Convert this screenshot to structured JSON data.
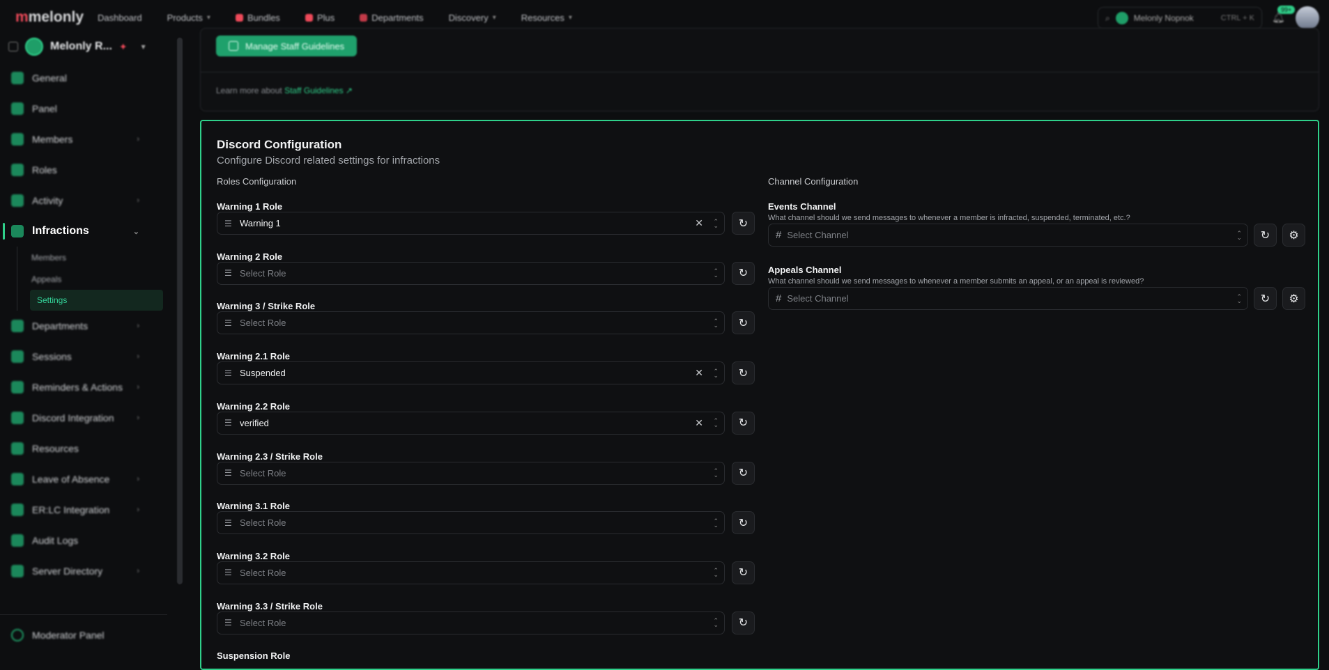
{
  "topnav": {
    "logo": "melonly",
    "items": [
      "Dashboard",
      "Products",
      "Bundles",
      "Plus",
      "Departments",
      "Discovery",
      "Resources"
    ],
    "search_server": "Melonly Nopnok",
    "search_shortcut": "CTRL + K",
    "notification_count": "99+"
  },
  "sidebar": {
    "server_name": "Melonly R...",
    "items": {
      "general": "General",
      "panel": "Panel",
      "members": "Members",
      "roles": "Roles",
      "activity": "Activity",
      "infractions": "Infractions",
      "departments": "Departments",
      "sessions": "Sessions",
      "reminders": "Reminders & Actions",
      "discord": "Discord Integration",
      "resources": "Resources",
      "loa": "Leave of Absence",
      "erlc": "ER:LC Integration",
      "audit": "Audit Logs",
      "directory": "Server Directory"
    },
    "sub_items": [
      "Members",
      "Appeals",
      "Settings"
    ],
    "moderator_panel": "Moderator Panel"
  },
  "top_card": {
    "button": "Manage Staff Guidelines",
    "learn_prefix": "Learn more about",
    "learn_link": "Staff Guidelines"
  },
  "config": {
    "title": "Discord Configuration",
    "subtitle": "Configure Discord related settings for infractions",
    "roles_header": "Roles Configuration",
    "channel_header": "Channel Configuration",
    "role_placeholder": "Select Role",
    "channel_placeholder": "Select Channel",
    "roles": [
      {
        "label": "Warning 1 Role",
        "value": "Warning 1"
      },
      {
        "label": "Warning 2 Role",
        "value": ""
      },
      {
        "label": "Warning 3 / Strike Role",
        "value": ""
      },
      {
        "label": "Warning 2.1 Role",
        "value": "Suspended"
      },
      {
        "label": "Warning 2.2 Role",
        "value": "verified"
      },
      {
        "label": "Warning 2.3 / Strike Role",
        "value": ""
      },
      {
        "label": "Warning 3.1 Role",
        "value": ""
      },
      {
        "label": "Warning 3.2 Role",
        "value": ""
      },
      {
        "label": "Warning 3.3 / Strike Role",
        "value": ""
      },
      {
        "label": "Suspension Role",
        "value": ""
      }
    ],
    "channels": [
      {
        "label": "Events Channel",
        "desc": "What channel should we send messages to whenever a member is infracted, suspended, terminated, etc.?"
      },
      {
        "label": "Appeals Channel",
        "desc": "What channel should we send messages to whenever a member submits an appeal, or an appeal is reviewed?"
      }
    ]
  },
  "colors": {
    "accent": "#2fd08a",
    "background": "#0d0e10",
    "card": "#0f1012",
    "border": "#2a2c30"
  }
}
